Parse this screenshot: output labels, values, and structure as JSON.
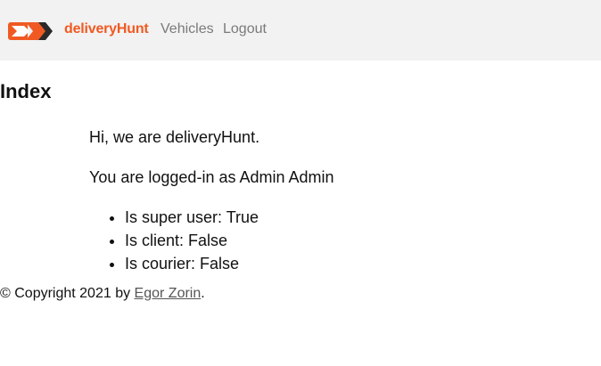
{
  "navbar": {
    "brand": "deliveryHunt",
    "links": [
      "Vehicles",
      "Logout"
    ],
    "logo_color": "#f05a22"
  },
  "main": {
    "title": "Index",
    "greeting": "Hi, we are deliveryHunt.",
    "logged_in_text": "You are logged-in as Admin Admin",
    "roles": [
      "Is super user: True",
      "Is client: False",
      "Is courier: False"
    ]
  },
  "footer": {
    "prefix": "© Copyright 2021 by ",
    "author": "Egor Zorin",
    "suffix": "."
  }
}
